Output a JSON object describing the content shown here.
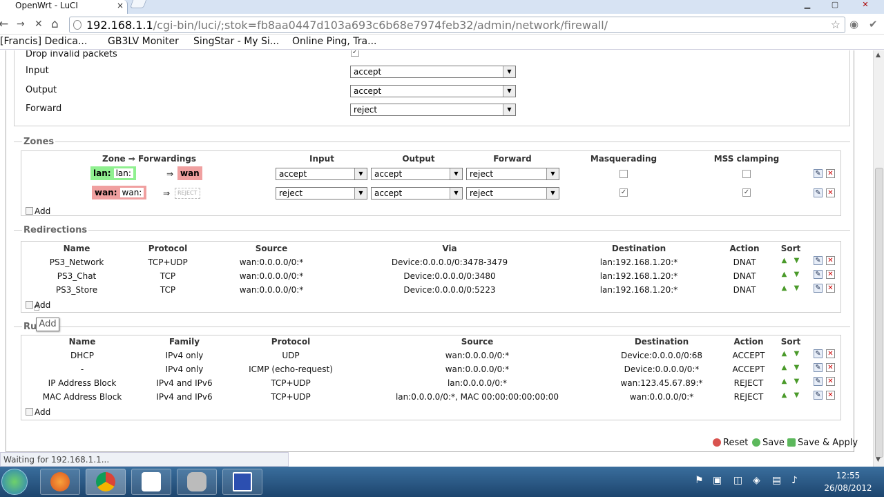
{
  "tab": {
    "title": "OpenWrt - LuCI",
    "close": "×"
  },
  "window": {
    "minimize": "▁",
    "maximize": "▢",
    "close": "✕"
  },
  "toolbar": {
    "back": "←",
    "forward": "→",
    "reload": "✕",
    "home": "⌂",
    "star": "☆"
  },
  "omnibox": {
    "host": "192.168.1.1",
    "path": "/cgi-bin/luci/;stok=fb8aa0447d103a693c6b68e7974feb32/admin/network/firewall/"
  },
  "bookmarks": [
    {
      "label": "[Francis] Dedica..."
    },
    {
      "label": "GB3LV Moniter"
    },
    {
      "label": "SingStar - My Si..."
    },
    {
      "label": "Online Ping, Tra..."
    }
  ],
  "general": {
    "drop_invalid_label": "Drop invalid packets",
    "drop_invalid_check": "✓",
    "input_label": "Input",
    "input_value": "accept",
    "output_label": "Output",
    "output_value": "accept",
    "forward_label": "Forward",
    "forward_value": "reject"
  },
  "zones": {
    "legend": "Zones",
    "headers": [
      "Zone ⇒ Forwardings",
      "Input",
      "Output",
      "Forward",
      "Masquerading",
      "MSS clamping"
    ],
    "rows": [
      {
        "zone": "lan:",
        "inner": "lan:",
        "arrow": "⇒",
        "dest": "wan",
        "input": "accept",
        "output": "accept",
        "forward": "reject",
        "masq": "",
        "mss": ""
      },
      {
        "zone": "wan:",
        "inner": "wan:",
        "arrow": "⇒",
        "dest": "REJECT",
        "input": "reject",
        "output": "accept",
        "forward": "reject",
        "masq": "✓",
        "mss": "✓"
      }
    ],
    "add": "Add"
  },
  "redirections": {
    "legend": "Redirections",
    "headers": [
      "Name",
      "Protocol",
      "Source",
      "Via",
      "Destination",
      "Action",
      "Sort"
    ],
    "rows": [
      {
        "name": "PS3_Network",
        "protocol": "TCP+UDP",
        "source": "wan:0.0.0.0/0:*",
        "via": "Device:0.0.0.0/0:3478-3479",
        "destination": "lan:192.168.1.20:*",
        "action": "DNAT"
      },
      {
        "name": "PS3_Chat",
        "protocol": "TCP",
        "source": "wan:0.0.0.0/0:*",
        "via": "Device:0.0.0.0/0:3480",
        "destination": "lan:192.168.1.20:*",
        "action": "DNAT"
      },
      {
        "name": "PS3_Store",
        "protocol": "TCP",
        "source": "wan:0.0.0.0/0:*",
        "via": "Device:0.0.0.0/0:5223",
        "destination": "lan:192.168.1.20:*",
        "action": "DNAT"
      }
    ],
    "add": "Add"
  },
  "rules": {
    "legend": "Ru",
    "headers": [
      "Name",
      "Family",
      "Protocol",
      "Source",
      "Destination",
      "Action",
      "Sort"
    ],
    "rows": [
      {
        "name": "DHCP",
        "family": "IPv4 only",
        "protocol": "UDP",
        "source": "wan:0.0.0.0/0:*",
        "destination": "Device:0.0.0.0/0:68",
        "action": "ACCEPT"
      },
      {
        "name": "-",
        "family": "IPv4 only",
        "protocol": "ICMP (echo-request)",
        "source": "wan:0.0.0.0/0:*",
        "destination": "Device:0.0.0.0/0:*",
        "action": "ACCEPT"
      },
      {
        "name": "IP Address Block",
        "family": "IPv4 and IPv6",
        "protocol": "TCP+UDP",
        "source": "lan:0.0.0.0/0:*",
        "destination": "wan:123.45.67.89:*",
        "action": "REJECT"
      },
      {
        "name": "MAC Address Block",
        "family": "IPv4 and IPv6",
        "protocol": "TCP+UDP",
        "source": "lan:0.0.0.0/0:*, MAC 00:00:00:00:00:00",
        "destination": "wan:0.0.0.0/0:*",
        "action": "REJECT"
      }
    ],
    "add": "Add"
  },
  "tooltip": "Add",
  "footer": {
    "reset": "Reset",
    "save": "Save",
    "save_apply": "Save & Apply"
  },
  "status": "Waiting for 192.168.1.1...",
  "clock": {
    "time": "12:55",
    "date": "26/08/2012"
  },
  "icons": {
    "edit": "✎",
    "delete": "✕",
    "sort_up": "▲",
    "sort_down": "▼",
    "dropdown": "▼"
  }
}
